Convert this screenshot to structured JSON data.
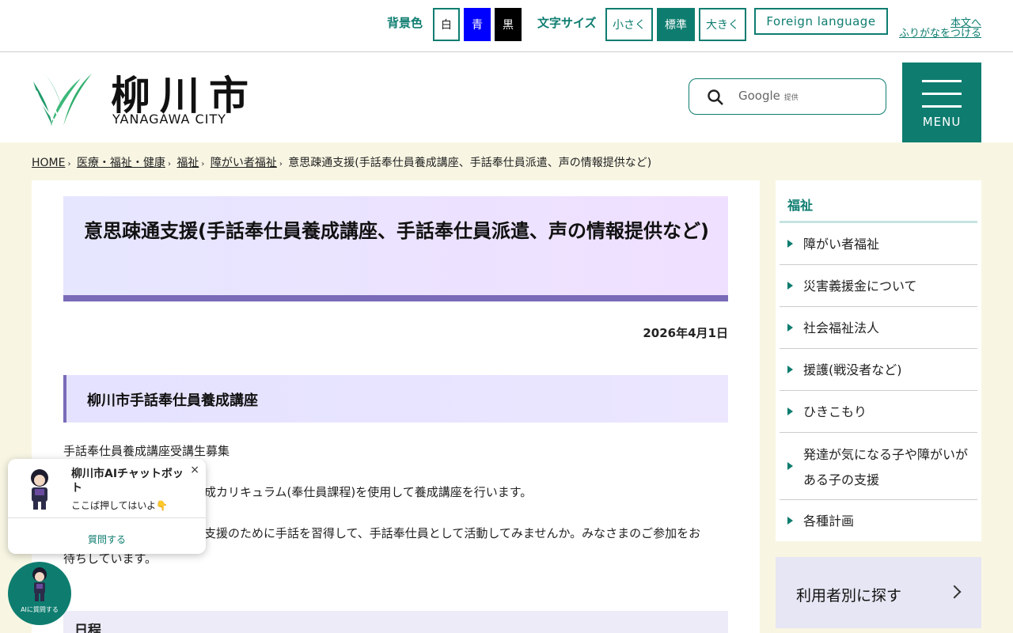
{
  "topbar": {
    "bg_label": "背景色",
    "bg_white": "白",
    "bg_blue": "青",
    "bg_black": "黒",
    "size_label": "文字サイズ",
    "size_small": "小さく",
    "size_normal": "標準",
    "size_large": "大きく",
    "foreign": "Foreign language",
    "skip": "本文へ",
    "furigana": "ふりがなをつける"
  },
  "header": {
    "logo_jp": "柳川市",
    "logo_en": "YANAGAWA CITY",
    "search_brand": "Google",
    "search_provided": "提供",
    "menu": "MENU"
  },
  "breadcrumb": {
    "home": "HOME",
    "c1": "医療・福祉・健康",
    "c2": "福祉",
    "c3": "障がい者福祉",
    "current": "意思疎通支援(手話奉仕員養成講座、手話奉仕員派遣、声の情報提供など)"
  },
  "main": {
    "title": "意思疎通支援(手話奉仕員養成講座、手話奉仕員派遣、声の情報提供など)",
    "date": "2026年4月1日",
    "h2": "柳川市手話奉仕員養成講座",
    "p1": "手話奉仕員養成講座受講生募集",
    "p2": "成カリキュラム(奉仕員課程)を使用して養成講座を行います。",
    "p3": "支援のために手話を習得して、手話奉仕員として活動してみませんか。みなさまのご参加をお",
    "p3b": "待ちしています。",
    "h3": "日程"
  },
  "sidebar": {
    "heading": "福祉",
    "items": [
      {
        "label": "障がい者福祉"
      },
      {
        "label": "災害義援金について"
      },
      {
        "label": "社会福祉法人"
      },
      {
        "label": "援護(戦没者など)"
      },
      {
        "label": "ひきこもり"
      },
      {
        "label": "発達が気になる子や障がいがある子の支援"
      },
      {
        "label": "各種計画"
      }
    ],
    "find": "利用者別に探す"
  },
  "chat": {
    "title": "柳川市AIチャットボット",
    "sub": "ここば押してはいよ👇",
    "close": "×",
    "ask": "質問する",
    "fab_label": "AIに質問する"
  },
  "colors": {
    "brand": "#0e7d70",
    "accent": "#7a6bb8",
    "page_bg": "#f8f6e3"
  }
}
